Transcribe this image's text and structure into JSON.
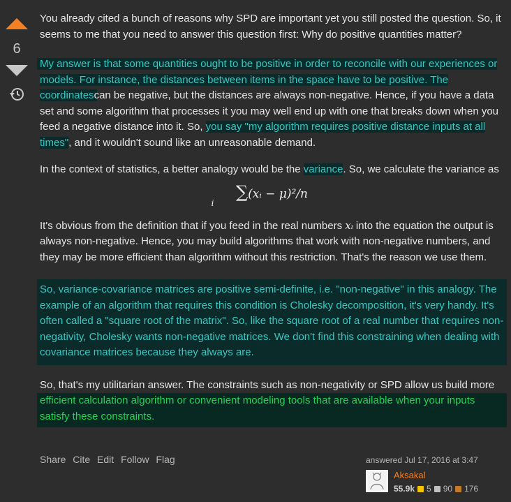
{
  "vote": {
    "score": "6"
  },
  "post": {
    "p1": "You already cited a bunch of reasons why SPD are important yet you still posted the question. So, it seems to me that you need to answer this question first: Why do positive quantities matter?",
    "p2_hl": "My answer is that some quantities ought to be positive in order to reconcile with our experiences or models. For instance, the distances between items in the space have to be positive. The coordinates",
    "p2_a": "can be negative, but the distances are always non-negative. Hence, if you have a data set and some algorithm that processes it you may well end up with one that breaks down when you feed a negative distance into it. So, ",
    "p2_hl2": "you say \"my algorithm requires positive distance inputs at all times\"",
    "p2_b": ", and it wouldn't sound like an unreasonable demand.",
    "p3_a": "In the context of statistics, a better analogy would be the ",
    "p3_hl": "variance",
    "p3_b": ". So, we calculate the variance as",
    "formula_sigma": "∑",
    "formula_body": "(xᵢ − μ)²/n",
    "formula_sub": "i",
    "p4_a": "It's obvious from the definition that if you feed in the real numbers ",
    "p4_math": "xᵢ",
    "p4_b": " into the equation the output is always non-negative. Hence, you may build algorithms that work with non-negative numbers, and they may be more efficient than algorithm without this restriction. That's the reason we use them.",
    "p5": "So, variance-covariance matrices are positive semi-definite, i.e. \"non-negative\" in this analogy. The example of an algorithm that requires this condition is Cholesky decomposition, it's very handy. It's often called a \"square root of the matrix\". So, like the square root of a real number that requires non-negativity, Cholesky wants non-negative matrices. We don't find this constraining when dealing with covariance matrices because they always are.",
    "p6_a": "So, that's my utilitarian answer. The constraints such as non-negativity or SPD allow us build more",
    "p6_hl": "efficient calculation algorithm or convenient modeling tools that are available when your inputs satisfy these constraints."
  },
  "actions": {
    "share": "Share",
    "cite": "Cite",
    "edit": "Edit",
    "follow": "Follow",
    "flag": "Flag"
  },
  "user": {
    "answered": "answered Jul 17, 2016 at 3:47",
    "name": "Aksakal",
    "reputation": "55.9k",
    "gold": "5",
    "silver": "90",
    "bronze": "176"
  }
}
